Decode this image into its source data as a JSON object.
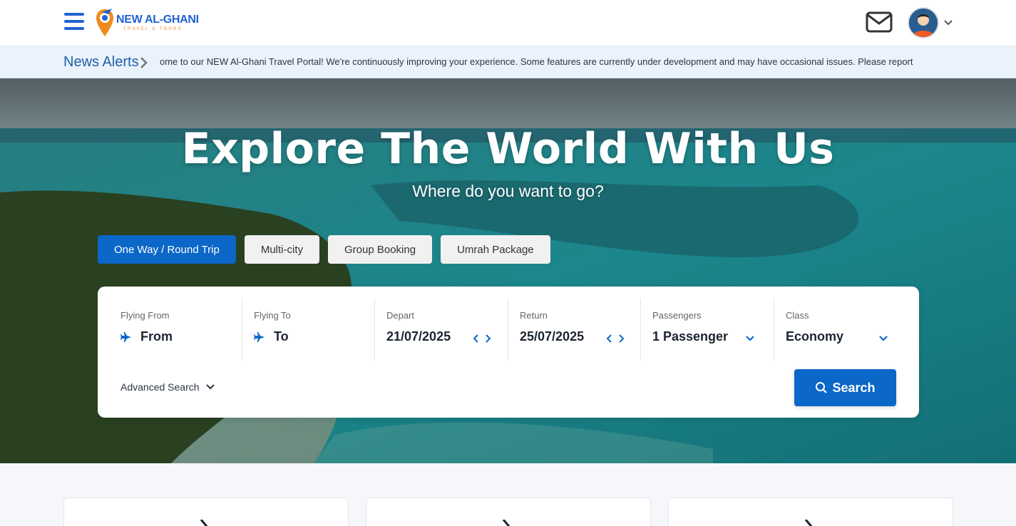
{
  "header": {
    "logo_main": "NEW AL-GHANI",
    "logo_sub": "TRAVEL & TOURS",
    "menu_icon": "hamburger-icon",
    "mail_icon": "mail-icon",
    "avatar_icon": "user-avatar",
    "brand_color": "#1f63d3",
    "accent_color": "#f08a1c"
  },
  "news": {
    "title": "News Alerts",
    "ticker": "ome to our NEW Al-Ghani Travel Portal! We're continuously improving your experience. Some features are currently under development and may have occasional issues. Please report"
  },
  "hero": {
    "title": "Explore The World With Us",
    "subtitle": "Where do you want to go?"
  },
  "tabs": [
    {
      "label": "One Way / Round Trip",
      "active": true
    },
    {
      "label": "Multi-city",
      "active": false
    },
    {
      "label": "Group Booking",
      "active": false
    },
    {
      "label": "Umrah Package",
      "active": false
    }
  ],
  "search": {
    "fields": [
      {
        "label": "Flying From",
        "value": "From"
      },
      {
        "label": "Flying To",
        "value": "To"
      },
      {
        "label": "Depart",
        "value": "21/07/2025"
      },
      {
        "label": "Return",
        "value": "25/07/2025"
      },
      {
        "label": "Passengers",
        "value": "1 Passenger"
      },
      {
        "label": "Class",
        "value": "Economy"
      }
    ],
    "advanced_label": "Advanced Search",
    "button_label": "Search",
    "button_color": "#0b67c8"
  }
}
